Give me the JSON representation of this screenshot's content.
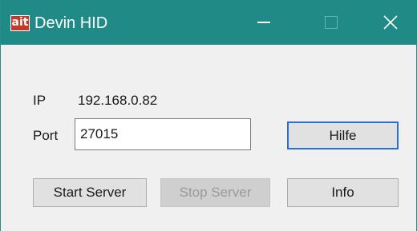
{
  "window": {
    "title": "Devin HID",
    "app_icon_text": "ait",
    "controls": {
      "minimize": "minimize-icon",
      "maximize": "maximize-icon",
      "close": "close-icon"
    },
    "accent_color": "#1f8a86"
  },
  "form": {
    "ip_label": "IP",
    "ip_value": "192.168.0.82",
    "port_label": "Port",
    "port_value": "27015"
  },
  "buttons": {
    "hilfe": "Hilfe",
    "start_server": "Start Server",
    "stop_server": "Stop Server",
    "info": "Info"
  }
}
